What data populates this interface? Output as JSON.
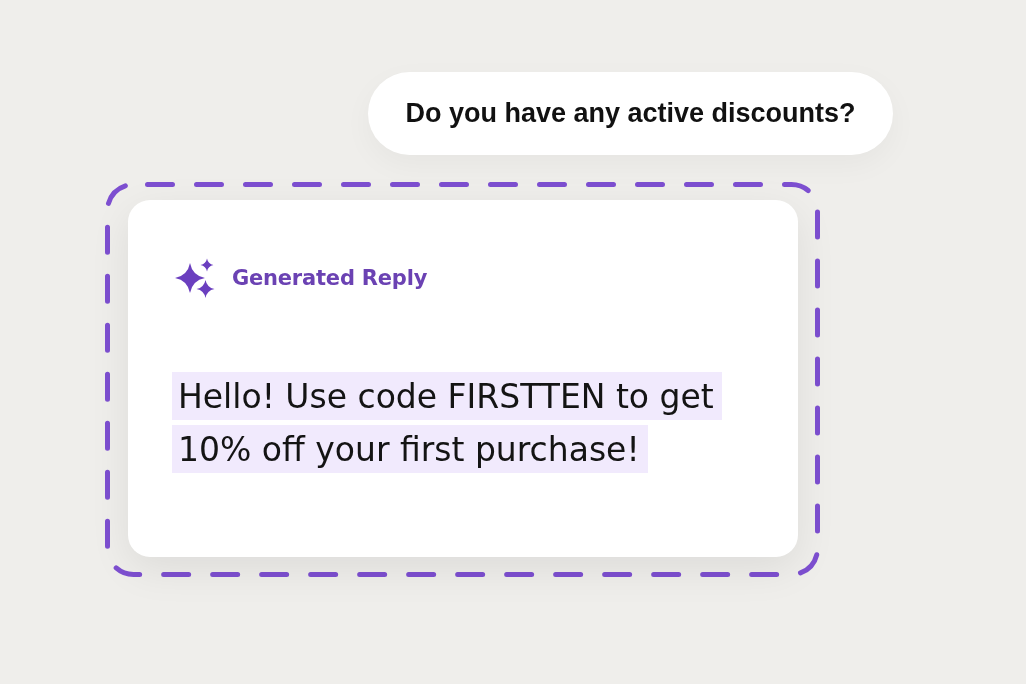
{
  "user_message": {
    "text": "Do you have any active discounts?"
  },
  "generated_reply": {
    "label": "Generated Reply",
    "text": "Hello! Use code FIRSTTEN to get 10% off your first purchase!",
    "highlighted": true
  }
}
